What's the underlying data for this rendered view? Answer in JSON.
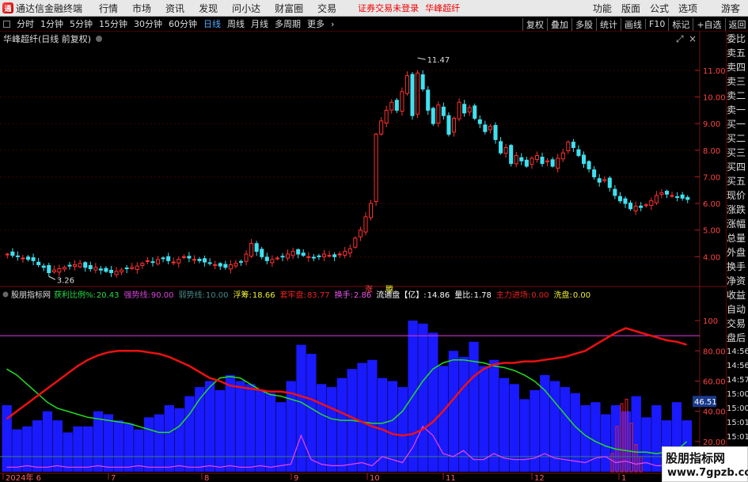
{
  "app": {
    "name": "通达信金融终端",
    "logo_text": "通"
  },
  "menu": [
    "行情",
    "市场",
    "资讯",
    "发现",
    "问小达",
    "财富圈",
    "交易"
  ],
  "warning": "证券交易未登录",
  "stock_name": "华峰超纤",
  "menu_right": [
    "功能",
    "版面",
    "公式",
    "选项",
    "游客"
  ],
  "periods": [
    "分时",
    "1分钟",
    "5分钟",
    "15分钟",
    "30分钟",
    "60分钟",
    "日线",
    "周线",
    "月线",
    "多周期",
    "更多"
  ],
  "active_period": "日线",
  "toolbar_right": [
    "复权",
    "叠加",
    "多股",
    "统计",
    "画线",
    "F10",
    "标记",
    "+自选",
    "返回"
  ],
  "price_title": "华峰超纤(日线 前复权)",
  "price_axis": [
    "11.00",
    "10.00",
    "9.00",
    "8.00",
    "7.00",
    "6.00",
    "5.00",
    "4.00"
  ],
  "high_label": "11.47",
  "low_label": "3.26",
  "markers": {
    "zhang": "涨",
    "teng": "腾"
  },
  "indicator": {
    "name": "股朋指标网",
    "items": [
      {
        "label": "获利比例%:",
        "value": "20.43",
        "color": "#22dd44"
      },
      {
        "label": "强势线:",
        "value": "90.00",
        "color": "#dd44dd"
      },
      {
        "label": "弱势线:",
        "value": "10.00",
        "color": "#4a8a8a"
      },
      {
        "label": "浮筹:",
        "value": "18.66",
        "color": "#eeee33"
      },
      {
        "label": "套牢盘:",
        "value": "83.77",
        "color": "#ee2222"
      },
      {
        "label": "换手:",
        "value": "2.86",
        "color": "#ee55ee"
      },
      {
        "label": "流通盘【亿】:",
        "value": "14.86",
        "color": "#ffffff"
      },
      {
        "label": "量比:",
        "value": "1.78",
        "color": "#ffffff"
      },
      {
        "label": "主力进场:",
        "value": "0.00",
        "color": "#ee2222"
      },
      {
        "label": "洗盘:",
        "value": "0.00",
        "color": "#eeee33"
      }
    ]
  },
  "indicator_axis": [
    "100",
    "80.00",
    "60.00",
    "40.00",
    "20.00"
  ],
  "current_value_tag": "46.51",
  "date_axis": [
    "2024年 6",
    "7",
    "8",
    "9",
    "10",
    "11",
    "12",
    "1"
  ],
  "right_panel": [
    "委比",
    "卖五",
    "卖四",
    "卖三",
    "卖二",
    "卖一",
    "买一",
    "买二",
    "买三",
    "买四",
    "买五",
    "现价",
    "涨跌",
    "涨幅",
    "总量",
    "外盘",
    "换手",
    "净资",
    "收益",
    "自动",
    "交易",
    "盘后",
    "14:56",
    "14:56",
    "14:57",
    "15:00",
    "15:00",
    "15:01",
    "15:01"
  ],
  "colors": {
    "up": "#ff3030",
    "down": "#40e0f0",
    "strong_line": "#cc33cc",
    "vol": "#1a1aff",
    "profit": "#22dd22",
    "trap": "#ee1111",
    "turnover": "#ee44ee"
  },
  "watermark": {
    "title": "股朋指标网",
    "url": "www.7gpzb.com"
  },
  "chart_data": [
    {
      "type": "candlestick",
      "title": "华峰超纤(日线 前复权)",
      "x_period": [
        "2024-06",
        "2025-01"
      ],
      "ylim": [
        3.0,
        11.8
      ],
      "high": 11.47,
      "low": 3.26,
      "close_series": [
        4.1,
        4.05,
        4.0,
        3.95,
        3.9,
        3.85,
        3.7,
        3.6,
        3.4,
        3.5,
        3.55,
        3.6,
        3.65,
        3.7,
        3.75,
        3.6,
        3.55,
        3.6,
        3.5,
        3.45,
        3.4,
        3.45,
        3.5,
        3.55,
        3.6,
        3.65,
        3.75,
        3.85,
        3.8,
        3.9,
        3.95,
        3.85,
        3.8,
        3.9,
        4.0,
        3.95,
        3.9,
        3.85,
        3.8,
        3.75,
        3.7,
        3.65,
        3.6,
        3.7,
        3.75,
        3.8,
        4.1,
        4.5,
        4.2,
        4.0,
        3.85,
        3.9,
        3.95,
        4.0,
        4.1,
        4.2,
        4.1,
        4.05,
        4.0,
        3.95,
        4.0,
        4.1,
        4.05,
        4.0,
        4.1,
        4.2,
        4.3,
        4.7,
        5.0,
        5.5,
        6.0,
        8.6,
        9.1,
        9.5,
        9.8,
        9.5,
        10.2,
        10.8,
        9.3,
        10.9,
        10.3,
        9.5,
        9.0,
        9.7,
        9.3,
        8.6,
        9.2,
        9.8,
        9.4,
        9.6,
        9.2,
        9.0,
        8.7,
        8.9,
        8.4,
        7.9,
        8.1,
        7.5,
        7.8,
        7.6,
        7.4,
        7.7,
        7.8,
        7.5,
        7.6,
        7.4,
        7.7,
        7.9,
        8.3,
        8.1,
        7.8,
        7.5,
        7.3,
        7.0,
        6.8,
        6.9,
        6.6,
        6.3,
        6.1,
        6.0,
        5.8,
        5.9,
        5.85,
        5.95,
        6.1,
        6.3,
        6.4,
        6.35,
        6.3,
        6.25,
        6.2,
        6.15
      ]
    },
    {
      "type": "mixed",
      "title": "股朋指标网",
      "ylim": [
        0,
        110
      ],
      "reference_lines": {
        "强势线": 90,
        "弱势线": 10
      },
      "series": [
        {
          "name": "套牢盘",
          "values": [
            35,
            40,
            45,
            50,
            55,
            60,
            65,
            70,
            74,
            77,
            79,
            80,
            80,
            80,
            79,
            78,
            76,
            73,
            70,
            66,
            62,
            60,
            57,
            56,
            55,
            54,
            53,
            53,
            52,
            50,
            48,
            45,
            42,
            39,
            36,
            33,
            30,
            28,
            25,
            24,
            25,
            28,
            33,
            40,
            48,
            56,
            63,
            68,
            71,
            72,
            72,
            73,
            73,
            74,
            75,
            76,
            78,
            80,
            84,
            88,
            92,
            95,
            93,
            91,
            89,
            87,
            86,
            84
          ]
        },
        {
          "name": "获利比例%",
          "values": [
            68,
            64,
            58,
            52,
            46,
            42,
            40,
            38,
            36,
            35,
            34,
            33,
            32,
            30,
            28,
            26,
            26,
            30,
            38,
            48,
            56,
            62,
            63,
            62,
            58,
            54,
            51,
            50,
            48,
            46,
            42,
            38,
            35,
            34,
            34,
            33,
            32,
            32,
            34,
            40,
            50,
            60,
            68,
            72,
            74,
            74,
            73,
            72,
            70,
            69,
            67,
            64,
            60,
            54,
            46,
            38,
            30,
            24,
            20,
            17,
            15,
            14,
            13,
            13,
            12,
            13,
            14,
            20
          ]
        },
        {
          "name": "换手",
          "values": [
            3,
            3,
            4,
            3,
            3,
            4,
            3,
            3,
            3,
            4,
            3,
            3,
            3,
            4,
            3,
            3,
            3,
            4,
            3,
            3,
            4,
            3,
            4,
            3,
            3,
            4,
            3,
            4,
            5,
            24,
            8,
            5,
            4,
            4,
            5,
            6,
            4,
            10,
            8,
            6,
            16,
            30,
            24,
            12,
            10,
            14,
            8,
            8,
            12,
            9,
            8,
            8,
            9,
            12,
            9,
            8,
            7,
            6,
            9,
            10,
            6,
            7,
            5,
            6,
            4,
            4,
            4,
            4
          ]
        },
        {
          "name": "量",
          "values": [
            44,
            28,
            30,
            34,
            40,
            34,
            26,
            30,
            30,
            40,
            38,
            34,
            32,
            28,
            36,
            38,
            44,
            42,
            50,
            56,
            60,
            54,
            64,
            60,
            58,
            54,
            52,
            46,
            60,
            84,
            78,
            58,
            56,
            62,
            68,
            72,
            74,
            62,
            60,
            56,
            100,
            98,
            92,
            70,
            80,
            76,
            86,
            70,
            74,
            62,
            58,
            48,
            54,
            64,
            60,
            56,
            52,
            44,
            46,
            38,
            44,
            40,
            50,
            36,
            44,
            34,
            46,
            34
          ]
        }
      ]
    }
  ]
}
